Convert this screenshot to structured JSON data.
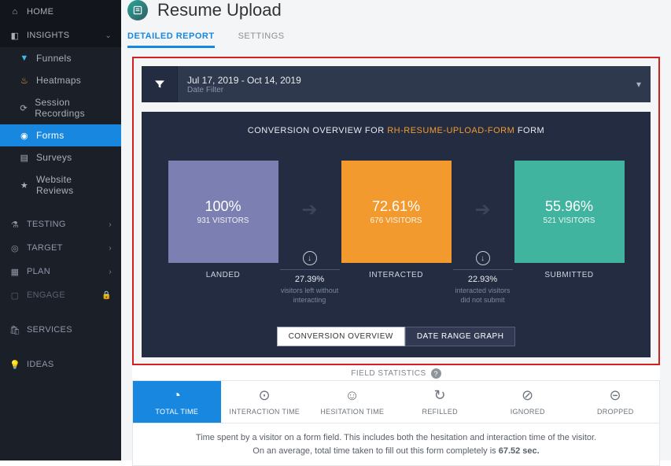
{
  "sidebar": {
    "home": "HOME",
    "insights": "INSIGHTS",
    "items": [
      {
        "label": "Funnels",
        "color": "#41b9e3"
      },
      {
        "label": "Heatmaps",
        "color": "#f2a349"
      },
      {
        "label": "Session Recordings",
        "color": "#aab0bb"
      },
      {
        "label": "Forms",
        "color": "#fff"
      },
      {
        "label": "Surveys",
        "color": "#aab0bb"
      },
      {
        "label": "Website Reviews",
        "color": "#aab0bb"
      }
    ],
    "sections": [
      "TESTING",
      "TARGET",
      "PLAN",
      "ENGAGE",
      "SERVICES",
      "IDEAS"
    ]
  },
  "header": {
    "title": "Resume Upload",
    "tabs": [
      "DETAILED REPORT",
      "SETTINGS"
    ]
  },
  "filter": {
    "value": "Jul 17, 2019 - Oct 14, 2019",
    "label": "Date Filter"
  },
  "overview": {
    "title_prefix": "CONVERSION OVERVIEW FOR",
    "form_id": "RH-RESUME-UPLOAD-FORM",
    "title_suffix": "FORM",
    "stages": [
      {
        "pct": "100%",
        "visitors": "931 VISITORS",
        "label": "LANDED"
      },
      {
        "pct": "72.61%",
        "visitors": "676 VISITORS",
        "label": "INTERACTED"
      },
      {
        "pct": "55.96%",
        "visitors": "521 VISITORS",
        "label": "SUBMITTED"
      }
    ],
    "gaps": [
      {
        "pct": "27.39%",
        "text": "visitors left without interacting"
      },
      {
        "pct": "22.93%",
        "text": "interacted visitors did not submit"
      }
    ],
    "btn_active": "CONVERSION OVERVIEW",
    "btn_inactive": "DATE RANGE GRAPH"
  },
  "field_stats": {
    "header": "FIELD STATISTICS",
    "tabs": [
      "TOTAL TIME",
      "INTERACTION TIME",
      "HESITATION TIME",
      "REFILLED",
      "IGNORED",
      "DROPPED"
    ],
    "desc_line1": "Time spent by a visitor on a form field. This includes both the hesitation and interaction time of the visitor.",
    "desc_line2_a": "On an average, total time taken to fill out this form completely is ",
    "desc_line2_b": "67.52 sec."
  },
  "chart_data": {
    "type": "bar",
    "title": "Conversion Overview for RH-RESUME-UPLOAD-FORM",
    "categories": [
      "Landed",
      "Interacted",
      "Submitted"
    ],
    "series": [
      {
        "name": "Conversion %",
        "values": [
          100,
          72.61,
          55.96
        ]
      },
      {
        "name": "Visitors",
        "values": [
          931,
          676,
          521
        ]
      }
    ],
    "dropoffs": [
      {
        "from": "Landed",
        "to": "Interacted",
        "pct": 27.39,
        "label": "visitors left without interacting"
      },
      {
        "from": "Interacted",
        "to": "Submitted",
        "pct": 22.93,
        "label": "interacted visitors did not submit"
      }
    ],
    "ylim": [
      0,
      100
    ]
  }
}
